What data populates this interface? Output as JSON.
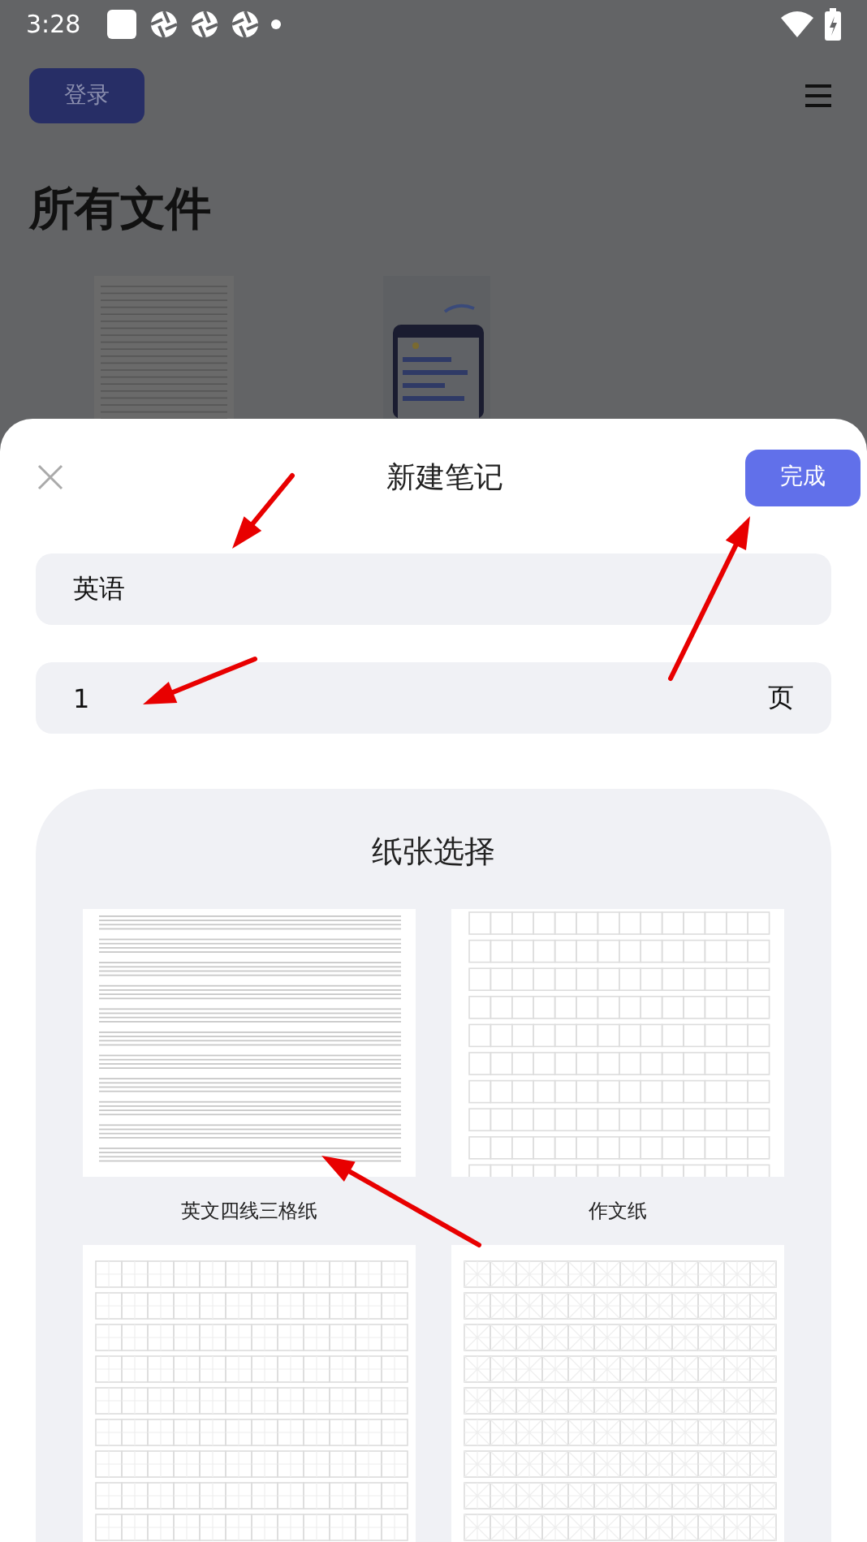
{
  "status_bar": {
    "time": "3:28"
  },
  "background": {
    "login_button": "登录",
    "title": "所有文件"
  },
  "dialog": {
    "title": "新建笔记",
    "done_button": "完成",
    "name_field": {
      "value": "英语"
    },
    "pages_field": {
      "value": "1",
      "unit": "页"
    },
    "paper": {
      "title": "纸张选择",
      "items": [
        {
          "label": "英文四线三格纸",
          "kind": "lines"
        },
        {
          "label": "作文纸",
          "kind": "grid"
        },
        {
          "kind": "tianzige"
        },
        {
          "kind": "mizige"
        }
      ]
    }
  }
}
